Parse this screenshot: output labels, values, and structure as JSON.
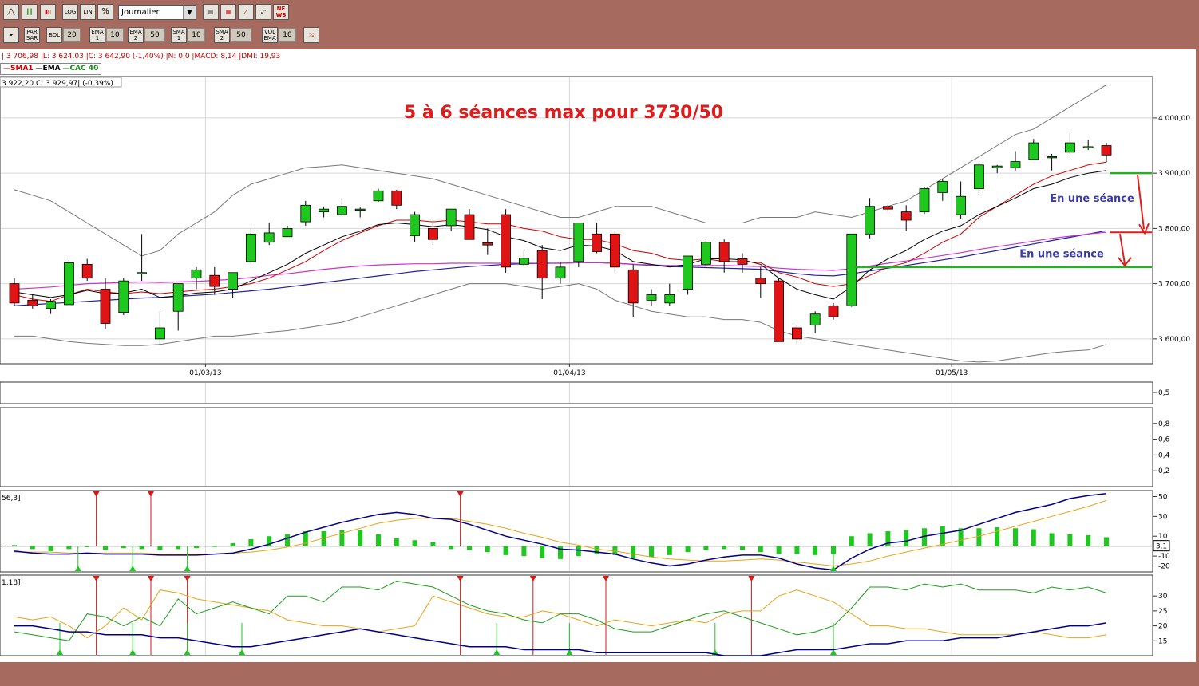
{
  "toolbar1": {
    "period_select": "Journalier",
    "log_label": "LOG",
    "lin_label": "LIN",
    "pct_label": "%",
    "news_label": "NE WS"
  },
  "toolbar2": {
    "parsar_label": "PAR SAR",
    "bol_label": "BOL",
    "bol_value": "20",
    "ema1_label": "EMA 1",
    "ema1_value": "10",
    "ema2_label": "EMA 2",
    "ema2_value": "50",
    "sma1_label": "SMA 1",
    "sma1_value": "10",
    "sma2_label": "SMA 2",
    "sma2_value": "50",
    "vol_label": "VOL EMA",
    "vol_value": "10"
  },
  "info": {
    "ohlc_line": "| 3 706,98 |L: 3 624,03 |C: 3 642,90 (-1,40%) |N: 0,0 |MACD: 8,14 |DMI: 19,93",
    "legend_sma": "SMA1",
    "legend_ema": "EMA",
    "legend_cac": "CAC 40",
    "quote_line": "3 922,20  C: 3 929,97| (-0,39%)",
    "macd_param": "56,3]",
    "dmi_param": "1,18]",
    "macd_value_box": "3,1"
  },
  "colors": {
    "bull": "#1ec81e",
    "bear": "#e01414",
    "sma": "#cc0000",
    "ema": "#000000",
    "ma_long": "#cc33cc",
    "ma_long2": "#2020a0",
    "bollinger": "#777777",
    "annotation_red": "#e01b1b",
    "annotation_blue": "#3a3aaa",
    "support_green": "#27b027",
    "macd_line": "#00008b",
    "macd_signal": "#e8a317",
    "dmi_plus": "#1e9e1e",
    "dmi_minus": "#e8a317",
    "adx": "#00008b"
  },
  "chart_data": [
    {
      "type": "candlestick",
      "title": "5 à 6 séances max pour  3730/50",
      "ylim": [
        3555,
        4075
      ],
      "yticks": [
        4000,
        3900,
        3800,
        3700,
        3600
      ],
      "ytick_labels": [
        "4 000,00",
        "3 900,00",
        "3 800,00",
        "3 700,00",
        "3 600,00"
      ],
      "x_labels": [
        {
          "index": 10.5,
          "label": "01/03/13"
        },
        {
          "index": 30.5,
          "label": "01/04/13"
        },
        {
          "index": 51.5,
          "label": "01/05/13"
        }
      ],
      "candles": [
        [
          3700,
          3710,
          3660,
          3665
        ],
        [
          3670,
          3680,
          3655,
          3660
        ],
        [
          3655,
          3672,
          3645,
          3668
        ],
        [
          3662,
          3743,
          3660,
          3738
        ],
        [
          3735,
          3745,
          3705,
          3710
        ],
        [
          3690,
          3710,
          3618,
          3628
        ],
        [
          3648,
          3710,
          3643,
          3705
        ],
        [
          3720,
          3790,
          3705,
          3720
        ],
        [
          3600,
          3650,
          3590,
          3620
        ],
        [
          3650,
          3700,
          3615,
          3700
        ],
        [
          3710,
          3730,
          3690,
          3725
        ],
        [
          3715,
          3730,
          3680,
          3695
        ],
        [
          3690,
          3720,
          3675,
          3720
        ],
        [
          3740,
          3800,
          3735,
          3790
        ],
        [
          3775,
          3810,
          3770,
          3792
        ],
        [
          3785,
          3805,
          3785,
          3800
        ],
        [
          3812,
          3850,
          3805,
          3842
        ],
        [
          3830,
          3840,
          3820,
          3835
        ],
        [
          3825,
          3855,
          3822,
          3840
        ],
        [
          3835,
          3838,
          3820,
          3835
        ],
        [
          3850,
          3872,
          3848,
          3868
        ],
        [
          3868,
          3870,
          3835,
          3842
        ],
        [
          3787,
          3830,
          3775,
          3825
        ],
        [
          3800,
          3810,
          3770,
          3780
        ],
        [
          3805,
          3832,
          3795,
          3835
        ],
        [
          3825,
          3835,
          3780,
          3780
        ],
        [
          3774,
          3800,
          3752,
          3770
        ],
        [
          3825,
          3835,
          3720,
          3730
        ],
        [
          3735,
          3760,
          3732,
          3746
        ],
        [
          3760,
          3770,
          3672,
          3710
        ],
        [
          3710,
          3740,
          3700,
          3730
        ],
        [
          3740,
          3810,
          3730,
          3810
        ],
        [
          3790,
          3810,
          3755,
          3758
        ],
        [
          3790,
          3795,
          3720,
          3730
        ],
        [
          3725,
          3735,
          3640,
          3665
        ],
        [
          3670,
          3690,
          3660,
          3680
        ],
        [
          3665,
          3700,
          3660,
          3680
        ],
        [
          3690,
          3750,
          3680,
          3750
        ],
        [
          3735,
          3780,
          3730,
          3775
        ],
        [
          3775,
          3780,
          3720,
          3740
        ],
        [
          3745,
          3755,
          3720,
          3735
        ],
        [
          3710,
          3730,
          3675,
          3700
        ],
        [
          3705,
          3710,
          3595,
          3595
        ],
        [
          3620,
          3625,
          3590,
          3600
        ],
        [
          3625,
          3650,
          3610,
          3645
        ],
        [
          3660,
          3665,
          3635,
          3640
        ],
        [
          3660,
          3790,
          3658,
          3790
        ],
        [
          3790,
          3855,
          3782,
          3840
        ],
        [
          3840,
          3845,
          3830,
          3835
        ],
        [
          3830,
          3842,
          3795,
          3815
        ],
        [
          3830,
          3875,
          3826,
          3872
        ],
        [
          3865,
          3890,
          3850,
          3885
        ],
        [
          3825,
          3885,
          3818,
          3858
        ],
        [
          3872,
          3920,
          3860,
          3915
        ],
        [
          3910,
          3915,
          3900,
          3913
        ],
        [
          3910,
          3940,
          3905,
          3921
        ],
        [
          3925,
          3962,
          3925,
          3955
        ],
        [
          3930,
          3935,
          3905,
          3930
        ],
        [
          3938,
          3972,
          3935,
          3955
        ],
        [
          3948,
          3960,
          3942,
          3948
        ],
        [
          3950,
          3955,
          3920,
          3933
        ]
      ],
      "bollinger_upper": [
        3870,
        3860,
        3850,
        3830,
        3810,
        3790,
        3770,
        3750,
        3760,
        3790,
        3810,
        3830,
        3860,
        3880,
        3890,
        3900,
        3910,
        3912,
        3915,
        3910,
        3905,
        3900,
        3895,
        3890,
        3880,
        3870,
        3860,
        3850,
        3840,
        3830,
        3820,
        3820,
        3830,
        3840,
        3840,
        3840,
        3830,
        3820,
        3810,
        3810,
        3810,
        3820,
        3820,
        3820,
        3830,
        3825,
        3820,
        3830,
        3840,
        3850,
        3870,
        3890,
        3910,
        3930,
        3950,
        3970,
        3980,
        4000,
        4020,
        4040,
        4060
      ],
      "bollinger_lower": [
        3605,
        3605,
        3600,
        3595,
        3592,
        3590,
        3588,
        3588,
        3590,
        3595,
        3600,
        3605,
        3605,
        3608,
        3612,
        3615,
        3620,
        3625,
        3630,
        3640,
        3650,
        3660,
        3670,
        3680,
        3690,
        3700,
        3700,
        3700,
        3695,
        3690,
        3695,
        3700,
        3690,
        3670,
        3660,
        3650,
        3645,
        3640,
        3640,
        3635,
        3635,
        3630,
        3615,
        3605,
        3600,
        3595,
        3590,
        3585,
        3580,
        3575,
        3570,
        3565,
        3560,
        3558,
        3560,
        3565,
        3570,
        3575,
        3578,
        3580,
        3590
      ],
      "sma": [
        3680,
        3672,
        3668,
        3680,
        3690,
        3685,
        3682,
        3685,
        3682,
        3685,
        3688,
        3690,
        3695,
        3700,
        3710,
        3725,
        3740,
        3760,
        3778,
        3792,
        3805,
        3815,
        3815,
        3812,
        3815,
        3812,
        3808,
        3808,
        3800,
        3795,
        3785,
        3780,
        3780,
        3772,
        3760,
        3755,
        3745,
        3742,
        3745,
        3740,
        3740,
        3738,
        3720,
        3712,
        3700,
        3695,
        3700,
        3715,
        3730,
        3738,
        3755,
        3775,
        3790,
        3820,
        3840,
        3860,
        3880,
        3895,
        3905,
        3915,
        3920
      ],
      "ema": [
        3685,
        3680,
        3675,
        3680,
        3688,
        3682,
        3683,
        3690,
        3675,
        3678,
        3683,
        3685,
        3690,
        3705,
        3720,
        3735,
        3755,
        3770,
        3785,
        3795,
        3807,
        3810,
        3807,
        3803,
        3807,
        3803,
        3798,
        3785,
        3778,
        3765,
        3760,
        3770,
        3768,
        3760,
        3740,
        3735,
        3730,
        3735,
        3745,
        3745,
        3743,
        3735,
        3710,
        3690,
        3680,
        3672,
        3695,
        3725,
        3745,
        3760,
        3780,
        3795,
        3805,
        3825,
        3840,
        3855,
        3872,
        3880,
        3892,
        3900,
        3905
      ],
      "ma_long": [
        3690,
        3692,
        3694,
        3697,
        3700,
        3701,
        3702,
        3703,
        3702,
        3703,
        3704,
        3706,
        3708,
        3711,
        3715,
        3718,
        3722,
        3726,
        3729,
        3732,
        3734,
        3735,
        3736,
        3736,
        3737,
        3737,
        3737,
        3737,
        3737,
        3737,
        3737,
        3738,
        3738,
        3737,
        3735,
        3734,
        3733,
        3733,
        3733,
        3733,
        3732,
        3731,
        3728,
        3726,
        3725,
        3724,
        3727,
        3732,
        3737,
        3741,
        3746,
        3751,
        3756,
        3762,
        3767,
        3772,
        3777,
        3782,
        3786,
        3790,
        3793
      ],
      "ma_long2": [
        3660,
        3662,
        3664,
        3666,
        3668,
        3670,
        3672,
        3674,
        3675,
        3677,
        3679,
        3681,
        3684,
        3687,
        3690,
        3694,
        3698,
        3702,
        3706,
        3710,
        3714,
        3718,
        3722,
        3725,
        3728,
        3731,
        3733,
        3735,
        3736,
        3737,
        3737,
        3738,
        3738,
        3737,
        3735,
        3733,
        3731,
        3730,
        3729,
        3728,
        3727,
        3726,
        3722,
        3718,
        3715,
        3714,
        3718,
        3723,
        3728,
        3733,
        3738,
        3743,
        3748,
        3754,
        3760,
        3766,
        3772,
        3778,
        3784,
        3790,
        3796
      ],
      "annotations": [
        {
          "text": "En une séance"
        },
        {
          "text": "En une séance"
        }
      ],
      "support_lines": [
        3900,
        3793,
        3730
      ]
    },
    {
      "type": "panel",
      "yticks": [
        0.5
      ]
    },
    {
      "type": "panel",
      "yticks": [
        0.8,
        0.6,
        0.4,
        0.2
      ]
    },
    {
      "type": "macd",
      "ylim": [
        -26,
        56
      ],
      "yticks": [
        50,
        30,
        10,
        -10,
        -20
      ],
      "macd": [
        -5,
        -7,
        -8,
        -8,
        -7,
        -8,
        -8,
        -8,
        -9,
        -9,
        -9,
        -8,
        -7,
        -3,
        2,
        8,
        14,
        19,
        24,
        28,
        32,
        34,
        32,
        28,
        27,
        22,
        16,
        10,
        6,
        2,
        -3,
        -4,
        -6,
        -8,
        -13,
        -17,
        -20,
        -18,
        -14,
        -11,
        -9,
        -9,
        -12,
        -18,
        -22,
        -24,
        -12,
        -3,
        3,
        5,
        10,
        13,
        16,
        22,
        28,
        34,
        38,
        42,
        48,
        51,
        53
      ],
      "signal": [
        -6,
        -6,
        -6,
        -7,
        -7,
        -7,
        -7,
        -7,
        -8,
        -8,
        -8,
        -8,
        -7,
        -6,
        -4,
        -1,
        3,
        8,
        13,
        18,
        23,
        26,
        28,
        28,
        28,
        25,
        22,
        18,
        13,
        9,
        4,
        1,
        -3,
        -5,
        -8,
        -11,
        -13,
        -14,
        -15,
        -15,
        -14,
        -13,
        -14,
        -16,
        -18,
        -20,
        -18,
        -15,
        -10,
        -6,
        -2,
        2,
        6,
        10,
        15,
        20,
        25,
        30,
        35,
        40,
        46
      ],
      "histogram": [
        1,
        -3,
        -5,
        -3,
        -1,
        -4,
        -2,
        -3,
        -4,
        -3,
        -2,
        0,
        3,
        7,
        10,
        12,
        15,
        15,
        16,
        16,
        12,
        8,
        6,
        4,
        -3,
        -4,
        -6,
        -9,
        -10,
        -12,
        -13,
        -10,
        -8,
        -9,
        -12,
        -11,
        -9,
        -6,
        -4,
        -3,
        -4,
        -6,
        -8,
        -8,
        -9,
        -8,
        10,
        13,
        15,
        16,
        18,
        20,
        18,
        18,
        19,
        18,
        17,
        13,
        12,
        11,
        9
      ],
      "buy_signal_index": [
        3.5,
        6.5,
        9.5,
        45
      ],
      "sell_signal_index": [
        4.5,
        7.5,
        24.5
      ]
    },
    {
      "type": "dmi",
      "ylim": [
        10,
        37
      ],
      "yticks": [
        30,
        25,
        20,
        15
      ],
      "dmi_plus": [
        18,
        17,
        16,
        15,
        24,
        23,
        20,
        23,
        20,
        29,
        24,
        26,
        28,
        26,
        24,
        30,
        30,
        28,
        33,
        33,
        32,
        35,
        34,
        33,
        30,
        27,
        25,
        24,
        22,
        21,
        24,
        24,
        22,
        19,
        18,
        18,
        20,
        22,
        24,
        25,
        23,
        21,
        19,
        17,
        18,
        20,
        26,
        33,
        33,
        32,
        34,
        33,
        34,
        32,
        32,
        32,
        31,
        33,
        32,
        33,
        31
      ],
      "dmi_minus": [
        23,
        22,
        23,
        20,
        16,
        20,
        26,
        22,
        32,
        31,
        29,
        28,
        27,
        26,
        25,
        22,
        21,
        20,
        20,
        19,
        18,
        19,
        20,
        30,
        28,
        26,
        24,
        23,
        23,
        25,
        24,
        22,
        20,
        22,
        21,
        20,
        21,
        22,
        21,
        24,
        25,
        25,
        30,
        32,
        30,
        28,
        24,
        20,
        20,
        19,
        19,
        18,
        17,
        17,
        17,
        17,
        18,
        17,
        16,
        16,
        17
      ],
      "adx": [
        20,
        20,
        19,
        18,
        18,
        17,
        17,
        17,
        16,
        16,
        15,
        14,
        13,
        13,
        14,
        15,
        16,
        17,
        18,
        19,
        18,
        17,
        16,
        15,
        14,
        13,
        13,
        13,
        12,
        12,
        12,
        12,
        11,
        11,
        11,
        11,
        11,
        11,
        11,
        10,
        10,
        10,
        11,
        12,
        12,
        12,
        13,
        14,
        14,
        15,
        15,
        15,
        16,
        16,
        16,
        17,
        18,
        19,
        20,
        20,
        21
      ],
      "cross_signal_index": [
        4.5,
        7.5,
        9.5,
        24.5,
        28.5,
        32.5,
        40.5
      ],
      "up_signal_index": [
        2.5,
        6.5,
        9.5,
        12.5,
        26.5,
        30.5,
        38.5,
        45
      ]
    }
  ]
}
